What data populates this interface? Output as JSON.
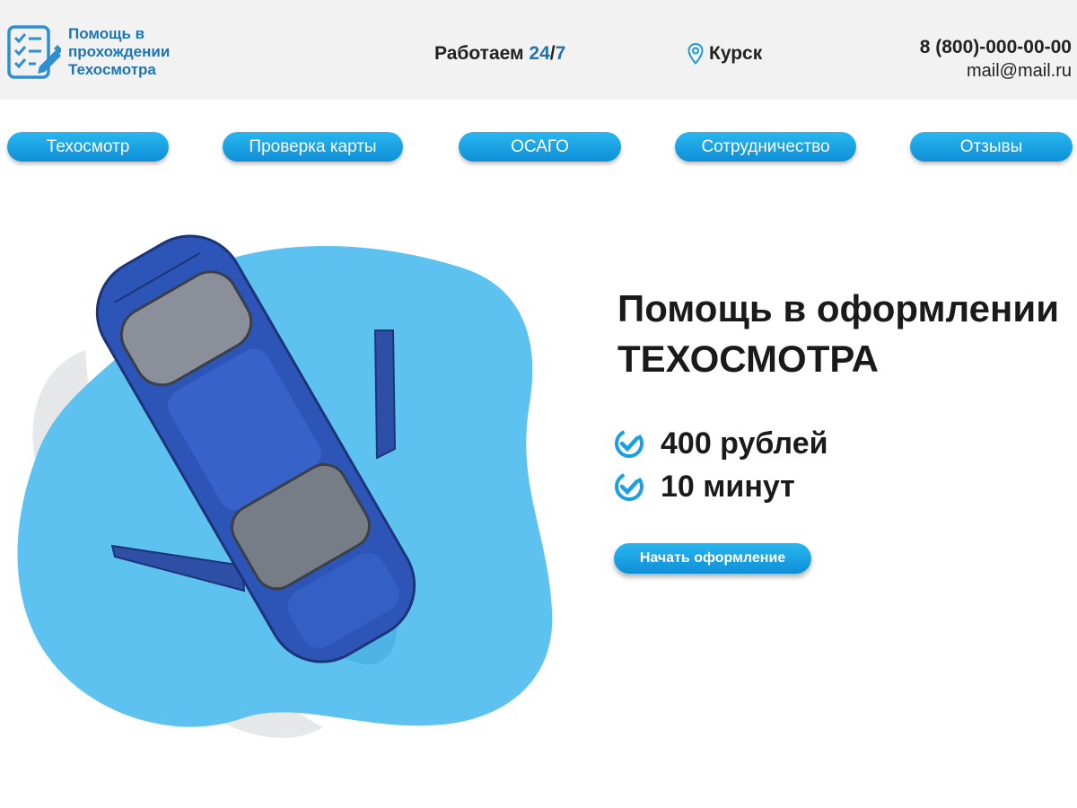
{
  "header": {
    "logo_text": "Помощь в прохождении Техосмотра",
    "schedule_prefix": "Работаем ",
    "schedule_accent_a": "24",
    "schedule_sep": "/",
    "schedule_accent_b": "7",
    "city": "Курск",
    "phone": "8 (800)-000-00-00",
    "email": "mail@mail.ru",
    "icons": {
      "logo": "checklist-pen-icon",
      "location": "map-pin-icon"
    }
  },
  "nav": {
    "items": [
      {
        "label": "Техосмотр"
      },
      {
        "label": "Проверка карты"
      },
      {
        "label": "ОСАГО"
      },
      {
        "label": "Сотрудничество"
      },
      {
        "label": "Отзывы"
      }
    ]
  },
  "hero": {
    "title_line1": "Помощь в оформлении",
    "title_line2": "ТЕХОСМОТРА",
    "features": [
      {
        "text": "400 рублей",
        "icon": "check-badge-icon"
      },
      {
        "text": "10 минут",
        "icon": "check-badge-icon"
      }
    ],
    "cta_label": "Начать оформление"
  },
  "colors": {
    "brand_blue": "#1e74b4",
    "button_blue": "#1a9fe4",
    "blob_blue": "#5ec2f0",
    "header_bg": "#f2f2f2",
    "car_blue": "#2d55b8"
  }
}
